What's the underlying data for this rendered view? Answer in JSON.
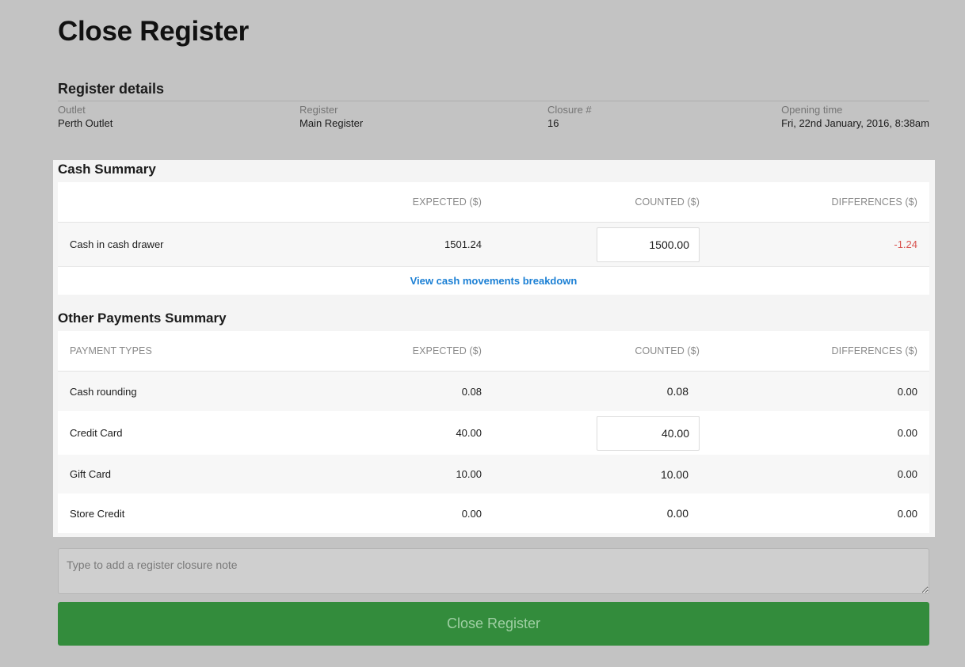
{
  "page_title": "Close Register",
  "register_details": {
    "title": "Register details",
    "fields": [
      {
        "label": "Outlet",
        "value": "Perth Outlet"
      },
      {
        "label": "Register",
        "value": "Main Register"
      },
      {
        "label": "Closure #",
        "value": "16"
      },
      {
        "label": "Opening time",
        "value": "Fri, 22nd January, 2016, 8:38am"
      }
    ]
  },
  "cash_summary": {
    "title": "Cash Summary",
    "headers": {
      "name": "",
      "expected": "EXPECTED ($)",
      "counted": "COUNTED ($)",
      "differences": "DIFFERENCES ($)"
    },
    "rows": [
      {
        "name": "Cash in cash drawer",
        "expected": "1501.24",
        "counted": "1500.00",
        "difference": "-1.24"
      }
    ],
    "breakdown_link": "View cash movements breakdown"
  },
  "other_payments": {
    "title": "Other Payments Summary",
    "headers": {
      "name": "PAYMENT TYPES",
      "expected": "EXPECTED ($)",
      "counted": "COUNTED ($)",
      "differences": "DIFFERENCES ($)"
    },
    "rows": [
      {
        "name": "Cash rounding",
        "expected": "0.08",
        "counted": "0.08",
        "difference": "0.00"
      },
      {
        "name": "Credit Card",
        "expected": "40.00",
        "counted": "40.00",
        "difference": "0.00"
      },
      {
        "name": "Gift Card",
        "expected": "10.00",
        "counted": "10.00",
        "difference": "0.00"
      },
      {
        "name": "Store Credit",
        "expected": "0.00",
        "counted": "0.00",
        "difference": "0.00"
      }
    ]
  },
  "note": {
    "placeholder": "Type to add a register closure note"
  },
  "close_button": {
    "label": "Close Register"
  },
  "colors": {
    "background": "#c3c3c3",
    "panel": "#f4f4f4",
    "link": "#1a7fd4",
    "negative": "#d9534f",
    "button": "#338c3c"
  }
}
